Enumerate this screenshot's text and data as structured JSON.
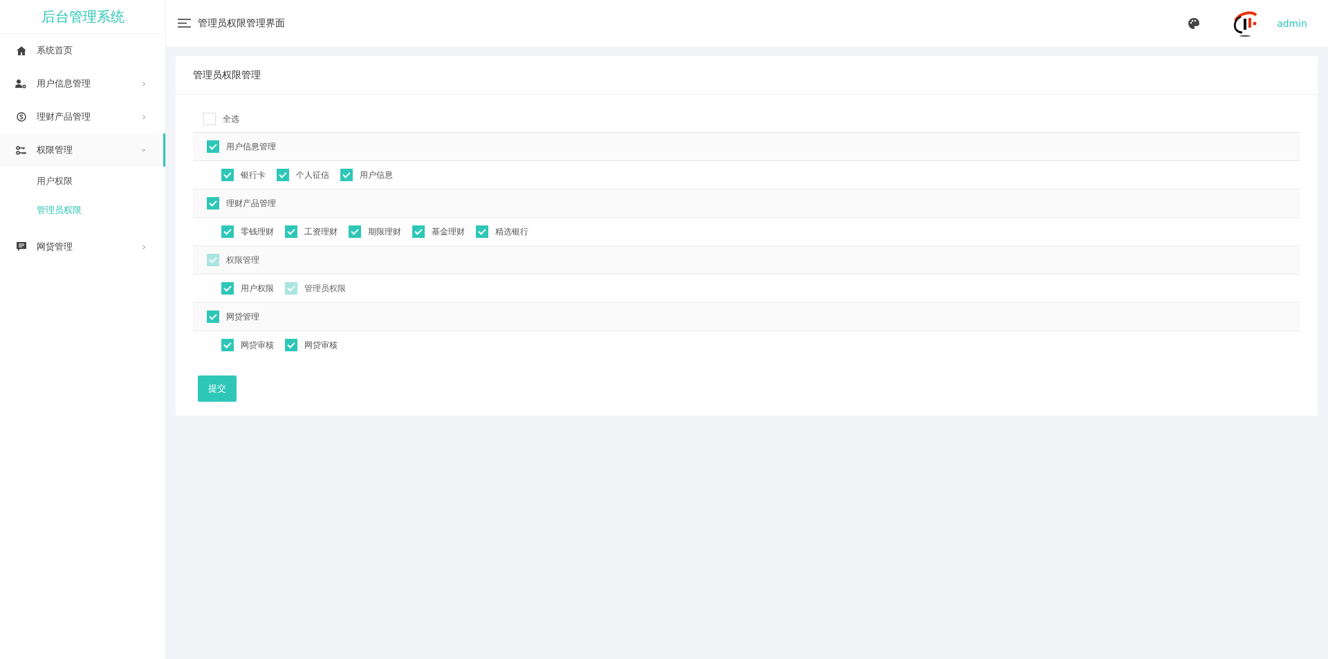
{
  "sidebar": {
    "title": "后台管理系统",
    "items": [
      {
        "label": "系统首页",
        "kind": "link",
        "selected": false
      },
      {
        "label": "用户信息管理",
        "kind": "submenu",
        "expanded": false,
        "selected": false
      },
      {
        "label": "理财产品管理",
        "kind": "submenu",
        "expanded": false,
        "selected": false
      },
      {
        "label": "权限管理",
        "kind": "submenu",
        "expanded": true,
        "selected": true,
        "children": [
          {
            "label": "用户权限",
            "selected": false
          },
          {
            "label": "管理员权限",
            "selected": true
          }
        ]
      },
      {
        "label": "网贷管理",
        "kind": "submenu",
        "expanded": false,
        "selected": false
      }
    ]
  },
  "header": {
    "title": "管理员权限管理界面",
    "user": "admin"
  },
  "card": {
    "title": "管理员权限管理",
    "select_all": {
      "label": "全选",
      "checked": false
    },
    "groups": [
      {
        "label": "用户信息管理",
        "checked": true,
        "disabled": false,
        "options": [
          {
            "label": "银行卡",
            "checked": true,
            "disabled": false
          },
          {
            "label": "个人征信",
            "checked": true,
            "disabled": false
          },
          {
            "label": "用户信息",
            "checked": true,
            "disabled": false
          }
        ]
      },
      {
        "label": "理财产品管理",
        "checked": true,
        "disabled": false,
        "options": [
          {
            "label": "零钱理财",
            "checked": true,
            "disabled": false
          },
          {
            "label": "工资理财",
            "checked": true,
            "disabled": false
          },
          {
            "label": "期限理财",
            "checked": true,
            "disabled": false
          },
          {
            "label": "基金理财",
            "checked": true,
            "disabled": false
          },
          {
            "label": "精选银行",
            "checked": true,
            "disabled": false
          }
        ]
      },
      {
        "label": "权限管理",
        "checked": true,
        "disabled": true,
        "options": [
          {
            "label": "用户权限",
            "checked": true,
            "disabled": false
          },
          {
            "label": "管理员权限",
            "checked": true,
            "disabled": true
          }
        ]
      },
      {
        "label": "网贷管理",
        "checked": true,
        "disabled": false,
        "options": [
          {
            "label": "网贷审核",
            "checked": true,
            "disabled": false
          },
          {
            "label": "网贷审核",
            "checked": true,
            "disabled": false
          }
        ]
      }
    ],
    "submit": "提交"
  }
}
